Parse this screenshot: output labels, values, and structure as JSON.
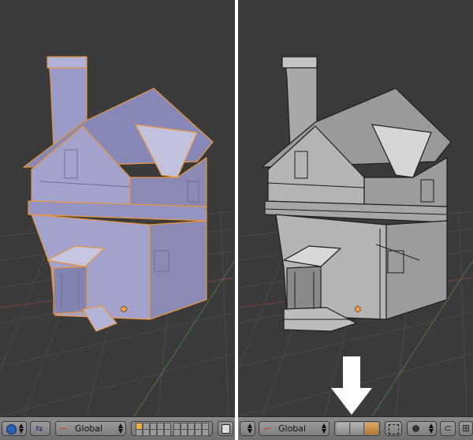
{
  "left_view": {
    "transform_orientation": "Global"
  },
  "right_view": {
    "transform_orientation": "Global"
  },
  "colors": {
    "viewport_bg": "#3a3a3a",
    "header_bg": "#7a7a7a",
    "selection_outline": "#e9953b",
    "arrow": "#ffffff"
  },
  "icons": [
    "pivot-icon",
    "manipulator-icon",
    "orientation-icon",
    "layers-icon",
    "snap-icon",
    "vertex-select-icon",
    "edge-select-icon",
    "face-select-icon",
    "limit-selection-icon",
    "proportional-edit-icon"
  ]
}
